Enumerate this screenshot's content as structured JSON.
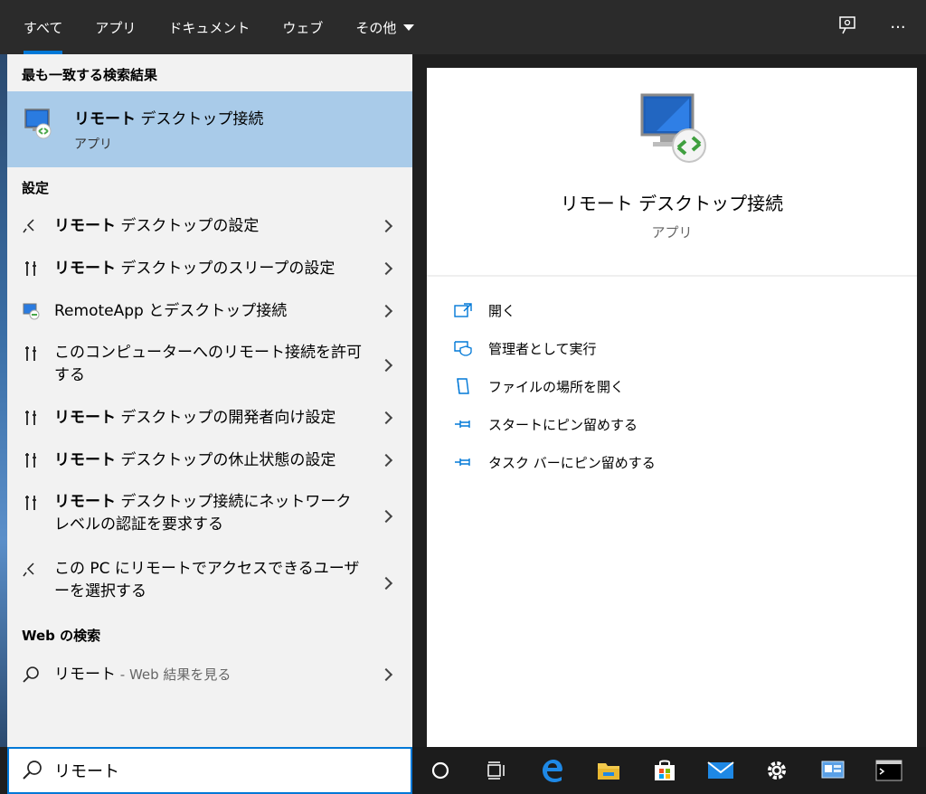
{
  "tabs": [
    {
      "label": "すべて",
      "active": true
    },
    {
      "label": "アプリ"
    },
    {
      "label": "ドキュメント"
    },
    {
      "label": "ウェブ"
    },
    {
      "label": "その他"
    }
  ],
  "top_icons": [
    "feedback-icon",
    "more-icon"
  ],
  "more_glyph": "···",
  "best_match": {
    "header": "最も一致する検索結果",
    "title_bold": "リモート",
    "title_rest": " デスクトップ接続",
    "subtitle": "アプリ"
  },
  "settings": {
    "header": "設定",
    "items": [
      {
        "bold": "リモート",
        "rest": " デスクトップの設定",
        "icon": "remote-icon"
      },
      {
        "bold": "リモート",
        "rest": " デスクトップのスリープの設定",
        "icon": "settings-tool-icon"
      },
      {
        "bold": "",
        "rest": "RemoteApp とデスクトップ接続",
        "icon": "remoteapp-icon"
      },
      {
        "bold": "",
        "rest": "このコンピューターへのリモート接続を許可する",
        "icon": "settings-tool-icon"
      },
      {
        "bold": "リモート",
        "rest": " デスクトップの開発者向け設定",
        "icon": "settings-tool-icon"
      },
      {
        "bold": "リモート",
        "rest": " デスクトップの休止状態の設定",
        "icon": "settings-tool-icon"
      },
      {
        "bold": "リモート",
        "rest": " デスクトップ接続にネットワーク レベルの認証を要求する",
        "icon": "settings-tool-icon"
      },
      {
        "bold": "",
        "rest": "この PC にリモートでアクセスできるユーザーを選択する",
        "icon": "remote-icon"
      }
    ]
  },
  "web": {
    "header": "Web の検索",
    "query": "リモート",
    "suffix": " - Web 結果を見る"
  },
  "preview": {
    "title": "リモート デスクトップ接続",
    "subtitle": "アプリ",
    "actions": [
      {
        "label": "開く",
        "icon": "open-icon"
      },
      {
        "label": "管理者として実行",
        "icon": "run-as-admin-icon"
      },
      {
        "label": "ファイルの場所を開く",
        "icon": "file-location-icon"
      },
      {
        "label": "スタートにピン留めする",
        "icon": "pin-icon"
      },
      {
        "label": "タスク バーにピン留めする",
        "icon": "pin-icon"
      }
    ]
  },
  "search": {
    "value": "リモート",
    "placeholder": ""
  },
  "taskbar": [
    "cortana-icon",
    "task-view-icon",
    "edge-icon",
    "file-explorer-icon",
    "store-icon",
    "mail-icon",
    "settings-icon",
    "control-panel-icon",
    "cmd-icon"
  ],
  "colors": {
    "accent": "#0078d7",
    "selected": "#a9cbe9",
    "topbar": "#2b2b2b"
  }
}
